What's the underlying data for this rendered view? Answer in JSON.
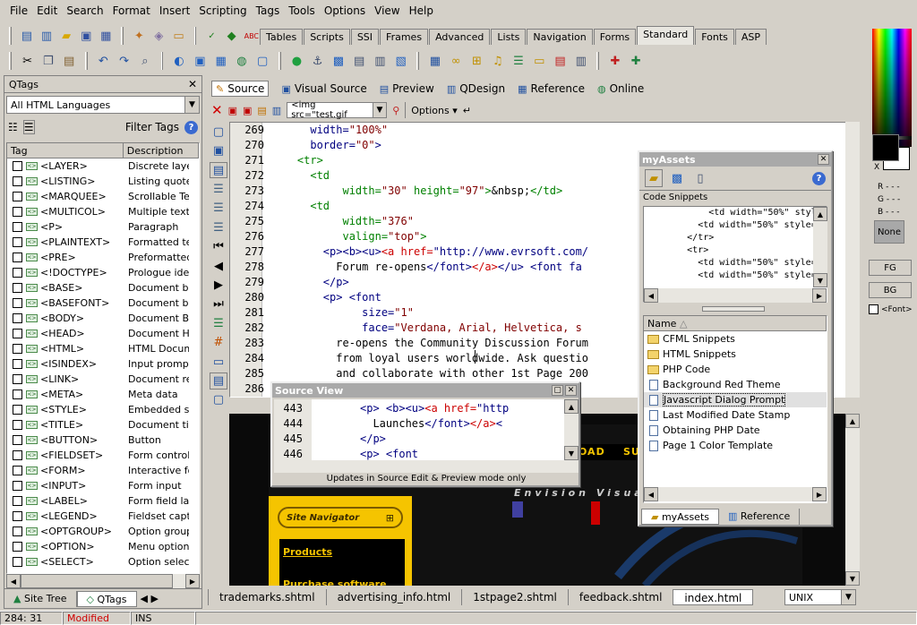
{
  "menu": [
    "File",
    "Edit",
    "Search",
    "Format",
    "Insert",
    "Scripting",
    "Tags",
    "Tools",
    "Options",
    "View",
    "Help"
  ],
  "tag_tabs": [
    "Tables",
    "Scripts",
    "SSI",
    "Frames",
    "Advanced",
    "Lists",
    "Navigation",
    "Forms",
    "Standard",
    "Fonts",
    "ASP"
  ],
  "active_tag_tab": "Standard",
  "qtags": {
    "title": "QTags",
    "language_select": "All HTML Languages",
    "filter_label": "Filter Tags",
    "col_tag": "Tag",
    "col_desc": "Description",
    "rows": [
      {
        "tag": "<LAYER>",
        "desc": "Discrete layer"
      },
      {
        "tag": "<LISTING>",
        "desc": "Listing quote"
      },
      {
        "tag": "<MARQUEE>",
        "desc": "Scrollable Tex"
      },
      {
        "tag": "<MULTICOL>",
        "desc": "Multiple text f"
      },
      {
        "tag": "<P>",
        "desc": "Paragraph"
      },
      {
        "tag": "<PLAINTEXT>",
        "desc": "Formatted tex"
      },
      {
        "tag": "<PRE>",
        "desc": "Preformatted"
      },
      {
        "tag": "<!DOCTYPE>",
        "desc": "Prologue iden"
      },
      {
        "tag": "<BASE>",
        "desc": "Document bas"
      },
      {
        "tag": "<BASEFONT>",
        "desc": "Document bas"
      },
      {
        "tag": "<BODY>",
        "desc": "Document Bod"
      },
      {
        "tag": "<HEAD>",
        "desc": "Document Hea"
      },
      {
        "tag": "<HTML>",
        "desc": "HTML Docume"
      },
      {
        "tag": "<ISINDEX>",
        "desc": "Input prompt"
      },
      {
        "tag": "<LINK>",
        "desc": "Document rela"
      },
      {
        "tag": "<META>",
        "desc": "Meta data"
      },
      {
        "tag": "<STYLE>",
        "desc": "Embedded sty"
      },
      {
        "tag": "<TITLE>",
        "desc": "Document title"
      },
      {
        "tag": "<BUTTON>",
        "desc": "Button"
      },
      {
        "tag": "<FIELDSET>",
        "desc": "Form control g"
      },
      {
        "tag": "<FORM>",
        "desc": "Interactive fo"
      },
      {
        "tag": "<INPUT>",
        "desc": "Form input"
      },
      {
        "tag": "<LABEL>",
        "desc": "Form field labe"
      },
      {
        "tag": "<LEGEND>",
        "desc": "Fieldset captio"
      },
      {
        "tag": "<OPTGROUP>",
        "desc": "Option group"
      },
      {
        "tag": "<OPTION>",
        "desc": "Menu option"
      },
      {
        "tag": "<SELECT>",
        "desc": "Option selecto"
      }
    ],
    "bottom_tabs": [
      "Site Tree",
      "QTags"
    ]
  },
  "view_tabs": [
    "Source",
    "Visual Source",
    "Preview",
    "QDesign",
    "Reference",
    "Online"
  ],
  "editor_toolbar": {
    "snippet_select": "<img src=\"test.gif",
    "options_label": "Options"
  },
  "code_lines": [
    {
      "n": "269",
      "indent": "      ",
      "html": "<span class='blue'>width=</span><span class='dkred'>\"100%\"</span>"
    },
    {
      "n": "270",
      "indent": "      ",
      "html": "<span class='blue'>border=</span><span class='dkred'>\"0\"</span><span class='blue'>></span>"
    },
    {
      "n": "271",
      "indent": "    ",
      "html": "<span class='grn'>&lt;tr&gt;</span>"
    },
    {
      "n": "272",
      "indent": "      ",
      "html": "<span class='grn'>&lt;td</span>"
    },
    {
      "n": "273",
      "indent": "           ",
      "html": "<span class='grn'>width=</span><span class='dkred'>\"30\"</span> <span class='grn'>height=</span><span class='dkred'>\"97\"</span><span class='grn'>&gt;</span>&amp;nbsp;<span class='grn'>&lt;/td&gt;</span>"
    },
    {
      "n": "274",
      "indent": "      ",
      "html": "<span class='grn'>&lt;td</span>"
    },
    {
      "n": "275",
      "indent": "           ",
      "html": "<span class='grn'>width=</span><span class='dkred'>\"376\"</span>"
    },
    {
      "n": "276",
      "indent": "           ",
      "html": "<span class='grn'>valign=</span><span class='dkred'>\"top\"</span><span class='grn'>&gt;</span>"
    },
    {
      "n": "277",
      "indent": "        ",
      "html": "<span class='blue'>&lt;p&gt;&lt;b&gt;&lt;u&gt;</span><span class='red'>&lt;a href=</span><span class='blue'>\"http://www.evrsoft.com/</span>"
    },
    {
      "n": "278",
      "indent": "          ",
      "html": "Forum re-opens<span class='blue'>&lt;/font&gt;</span><span class='red'>&lt;/a&gt;</span><span class='blue'>&lt;/u&gt; &lt;font fa</span>"
    },
    {
      "n": "279",
      "indent": "        ",
      "html": "<span class='blue'>&lt;/p&gt;</span>"
    },
    {
      "n": "280",
      "indent": "        ",
      "html": "<span class='blue'>&lt;p&gt; &lt;font</span>"
    },
    {
      "n": "281",
      "indent": "              ",
      "html": "<span class='blue'>size=</span><span class='dkred'>\"1\"</span>"
    },
    {
      "n": "282",
      "indent": "              ",
      "html": "<span class='blue'>face=</span><span class='dkred'>\"Verdana, Arial, Helvetica, s</span>"
    },
    {
      "n": "283",
      "indent": "          ",
      "html": "re-opens the Community Discussion Forum"
    },
    {
      "n": "284",
      "indent": "          ",
      "html": "from loyal users worldwide. Ask questio"
    },
    {
      "n": "285",
      "indent": "          ",
      "html": "and collaborate with other 1st Page 200"
    },
    {
      "n": "286",
      "indent": "          ",
      "html": ""
    }
  ],
  "source_view": {
    "title": "Source View",
    "status": "Updates in Source Edit & Preview mode only",
    "lines": [
      {
        "n": "443",
        "html": "<span class='blue'>&lt;p&gt; &lt;b&gt;&lt;u&gt;</span><span class='red'>&lt;a href=</span><span class='blue'>\"http</span>"
      },
      {
        "n": "444",
        "html": "  Launches<span class='blue'>&lt;/font&gt;</span><span class='red'>&lt;/a&gt;</span><span class='blue'>&lt;</span>"
      },
      {
        "n": "445",
        "html": "<span class='blue'>&lt;/p&gt;</span>"
      },
      {
        "n": "446",
        "html": "<span class='blue'>&lt;p&gt; &lt;font</span>"
      }
    ]
  },
  "myassets": {
    "title": "myAssets",
    "snippets_label": "Code Snippets",
    "snippet_lines": [
      "            <td width=\"50%\" style=\"bor",
      "          <td width=\"50%\" style=\"borde",
      "        </tr>",
      "        <tr>",
      "          <td width=\"50%\" style=\"borde",
      "          <td width=\"50%\" style=\"borde"
    ],
    "name_col": "Name",
    "items": [
      {
        "label": "CFML Snippets",
        "type": "folder"
      },
      {
        "label": "HTML Snippets",
        "type": "folder"
      },
      {
        "label": "PHP Code",
        "type": "folder"
      },
      {
        "label": "Background Red Theme",
        "type": "doc"
      },
      {
        "label": "Javascript Dialog Prompt",
        "type": "doc",
        "selected": true
      },
      {
        "label": "Last Modified Date Stamp",
        "type": "doc"
      },
      {
        "label": "Obtaining PHP Date",
        "type": "doc"
      },
      {
        "label": "Page 1 Color Template",
        "type": "doc"
      }
    ],
    "tabs": [
      "myAssets",
      "Reference"
    ]
  },
  "preview": {
    "nav_label": "Site Navigator",
    "products": "Products",
    "purchase": "Purchase software",
    "tagline": "Envision Visua",
    "menu_a": "OAD",
    "menu_b": "SU"
  },
  "file_tabs": [
    "trademarks.shtml",
    "advertising_info.html",
    "1stpage2.shtml",
    "feedback.shtml",
    "index.html"
  ],
  "active_file": "index.html",
  "line_ending": "UNIX",
  "color_panel": {
    "r": "R - - -",
    "g": "G - - -",
    "b": "B - - -",
    "none": "None",
    "fg": "FG",
    "bg": "BG",
    "font": "<Font>",
    "x": "X"
  },
  "status": {
    "pos": "284: 31",
    "modified": "Modified",
    "ins": "INS"
  },
  "colors": {
    "preview_bg": "#0a0a0a",
    "yellow": "#f5c400",
    "accent_red": "#cc0000"
  }
}
